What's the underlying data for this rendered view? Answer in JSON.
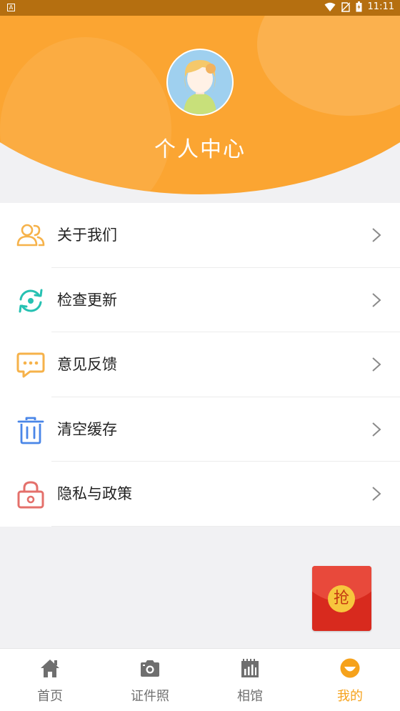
{
  "status_bar": {
    "time": "11:11",
    "left_icon": "A",
    "icons": [
      "wifi-icon",
      "no-sim-icon",
      "battery-icon"
    ]
  },
  "header": {
    "title": "个人中心",
    "avatar": "avatar-icon",
    "background_color": "#fba532"
  },
  "menu": [
    {
      "label": "关于我们",
      "icon": "users-icon",
      "color": "#f6b24a"
    },
    {
      "label": "检查更新",
      "icon": "refresh-icon",
      "color": "#26c1b2"
    },
    {
      "label": "意见反馈",
      "icon": "chat-icon",
      "color": "#f6b24a"
    },
    {
      "label": "清空缓存",
      "icon": "trash-icon",
      "color": "#4a86e8"
    },
    {
      "label": "隐私与政策",
      "icon": "lock-icon",
      "color": "#e4706b"
    }
  ],
  "floating": {
    "red_packet_text": "抢"
  },
  "bottom_nav": [
    {
      "label": "首页",
      "icon": "home-icon",
      "active": false
    },
    {
      "label": "证件照",
      "icon": "camera-icon",
      "active": false
    },
    {
      "label": "相馆",
      "icon": "studio-icon",
      "active": false
    },
    {
      "label": "我的",
      "icon": "smile-icon",
      "active": true
    }
  ],
  "colors": {
    "accent": "#f6a21b",
    "inactive": "#6f6f6f"
  }
}
